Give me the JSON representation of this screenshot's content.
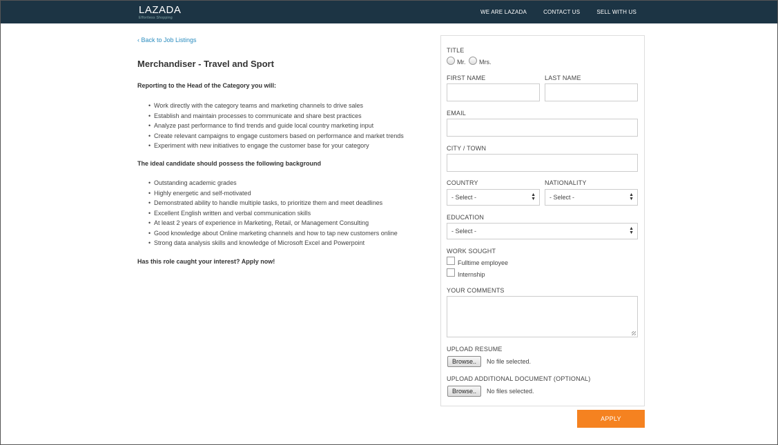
{
  "header": {
    "logo_text": "LAZADA",
    "logo_tagline": "Effortless Shopping",
    "nav": [
      "WE ARE LAZADA",
      "CONTACT US",
      "SELL WITH US"
    ]
  },
  "job": {
    "back_link": "Back to Job Listings",
    "back_icon": "chevron-left-icon",
    "title": "Merchandiser - Travel and Sport",
    "section1_heading": "Reporting to the Head of the Category you will:",
    "section1_items": [
      "Work directly with the category teams and marketing channels to drive sales",
      "Establish and maintain processes to communicate and share best practices",
      "Analyze past performance to find trends and guide local country marketing input",
      "Create relevant campaigns to engage customers based on performance and market trends",
      "Experiment with new initiatives to engage the customer base for your category"
    ],
    "section2_heading": "The ideal candidate should possess the following background",
    "section2_items": [
      "Outstanding academic grades",
      "Highly energetic and self-motivated",
      "Demonstrated ability to handle multiple tasks, to prioritize them and meet deadlines",
      "Excellent English written and verbal communication skills",
      "At least 2 years of experience in Marketing, Retail, or Management Consulting",
      "Good knowledge about Online marketing channels and how to tap new customers online",
      "Strong data analysis skills and knowledge of Microsoft Excel and Powerpoint"
    ],
    "closing": "Has this role caught your interest? Apply now!"
  },
  "form": {
    "title_label": "TITLE",
    "title_options": [
      "Mr.",
      "Mrs."
    ],
    "first_name_label": "FIRST NAME",
    "first_name_value": "",
    "last_name_label": "LAST NAME",
    "last_name_value": "",
    "email_label": "EMAIL",
    "email_value": "",
    "city_label": "CITY / TOWN",
    "city_value": "",
    "country_label": "COUNTRY",
    "country_value": "- Select -",
    "nationality_label": "NATIONALITY",
    "nationality_value": "- Select -",
    "education_label": "EDUCATION",
    "education_value": "- Select -",
    "work_sought_label": "WORK SOUGHT",
    "work_options": [
      "Fulltime employee",
      "Internship"
    ],
    "comments_label": "YOUR COMMENTS",
    "comments_value": "",
    "resume_label": "UPLOAD RESUME",
    "resume_button": "Browse..",
    "resume_status": "No file selected.",
    "additional_label": "UPLOAD ADDITIONAL DOCUMENT (OPTIONAL)",
    "additional_button": "Browse..",
    "additional_status": "No files selected.",
    "apply_button": "APPLY"
  },
  "colors": {
    "header_bg": "#1c3444",
    "link": "#2a8cbf",
    "apply_bg": "#f58220"
  }
}
